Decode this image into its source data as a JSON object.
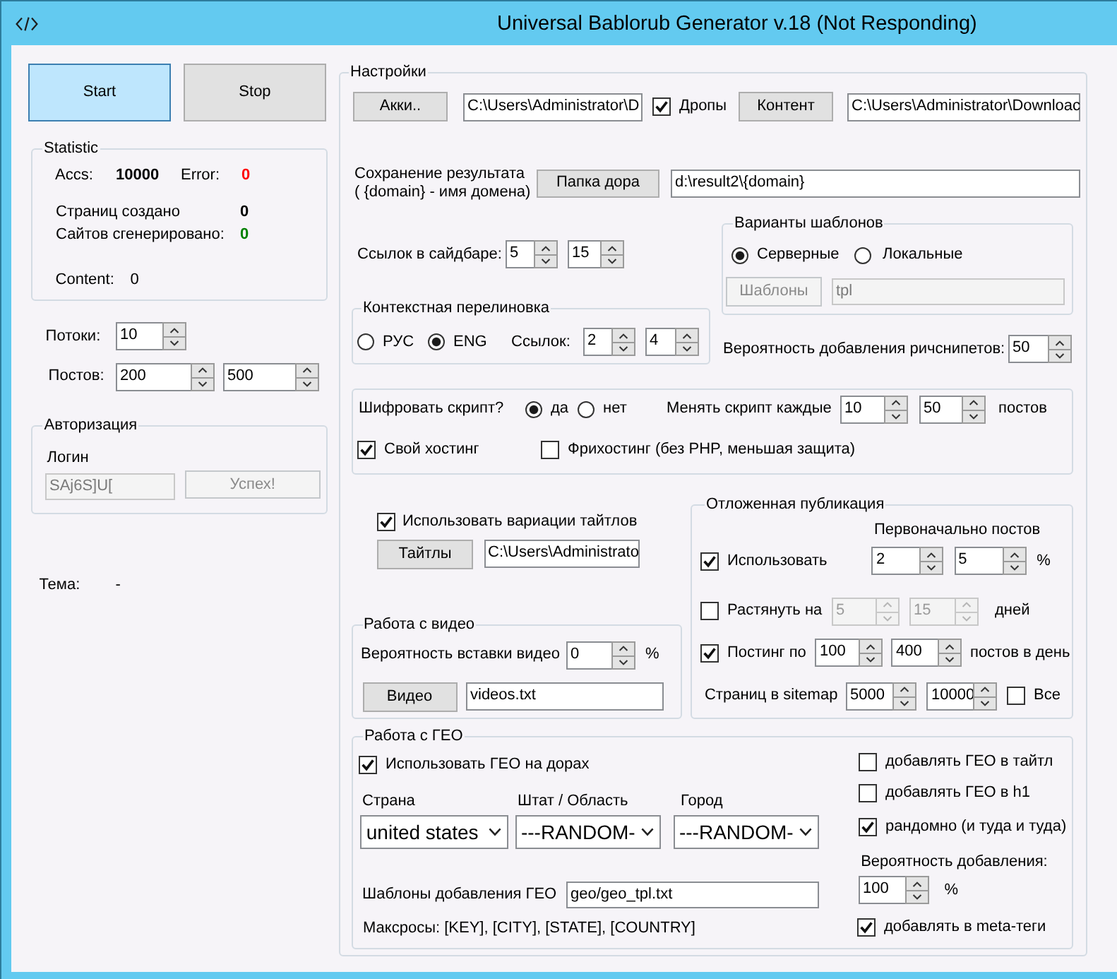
{
  "window": {
    "title": "Universal Bablorub Generator v.18 (Not Responding)"
  },
  "actions": [
    {
      "label": "Start",
      "highlighted": true
    },
    {
      "label": "Stop",
      "highlighted": false
    }
  ],
  "statistic": {
    "title": "Statistic",
    "top_row": [
      {
        "label": "Accs:",
        "value": "10000",
        "color": "#000000"
      },
      {
        "label": "Error:",
        "value": "0",
        "color": "#ff0000"
      }
    ],
    "counters": [
      {
        "label": "Страниц создано",
        "value": "0",
        "color": "#000000"
      },
      {
        "label": "Сайтов сгенерировано:",
        "value": "0",
        "color": "#008000"
      }
    ],
    "content": {
      "label": "Content:",
      "value": "0"
    }
  },
  "threads": {
    "label": "Потоки:",
    "values": [
      {
        "value": "10"
      }
    ]
  },
  "posts": {
    "label": "Постов:",
    "values": [
      {
        "value": "200"
      },
      {
        "value": "500"
      }
    ]
  },
  "authorization": {
    "title": "Авторизация",
    "login_label": "Логин",
    "login": {
      "value": "SAj6S]U[",
      "disabled": true
    },
    "button": {
      "label": "Успех!",
      "disabled": true
    }
  },
  "theme": {
    "label": "Тема:",
    "value": "-"
  },
  "settings": {
    "title": "Настройки",
    "accounts": {
      "button": {
        "label": "Акки.."
      },
      "path": {
        "value": "C:\\Users\\Administrator\\D"
      }
    },
    "drops": {
      "label": "Дропы",
      "checked": true
    },
    "content": {
      "button": {
        "label": "Контент"
      },
      "path": {
        "value": "C:\\Users\\Administrator\\Downloac"
      }
    },
    "output": {
      "label_lines": [
        "Сохранение результата",
        "( {domain} - имя домена)"
      ],
      "button": {
        "label": "Папка дора"
      },
      "path": {
        "value": "d:\\result2\\{domain}"
      }
    },
    "sidebar_links": {
      "label": "Ссылок в сайдбаре:",
      "values": [
        {
          "value": "5"
        },
        {
          "value": "15"
        }
      ]
    },
    "context_linking": {
      "title": "Контекстная перелиновка",
      "languages": [
        {
          "label": "РУС",
          "selected": false
        },
        {
          "label": "ENG",
          "selected": true
        }
      ],
      "links_label": "Ссылок:",
      "values": [
        {
          "value": "2"
        },
        {
          "value": "4"
        }
      ]
    },
    "template_variants": {
      "title": "Варианты шаблонов",
      "options": [
        {
          "label": "Серверные",
          "selected": true
        },
        {
          "label": "Локальные",
          "selected": false
        }
      ],
      "button": {
        "label": "Шаблоны",
        "disabled": true
      },
      "path": {
        "value": "tpl",
        "disabled": true
      }
    },
    "rich_snippets": {
      "label": "Вероятность добавления ричснипетов:",
      "values": [
        {
          "value": "50"
        }
      ]
    },
    "script": {
      "encrypt_label": "Шифровать скрипт?",
      "encrypt_options": [
        {
          "label": "да",
          "selected": true
        },
        {
          "label": "нет",
          "selected": false
        }
      ],
      "change_label": "Менять скрипт каждые",
      "values": [
        {
          "value": "10"
        },
        {
          "value": "50"
        }
      ],
      "unit": "постов",
      "hosting": [
        {
          "label": "Свой хостинг",
          "checked": true
        },
        {
          "label": "Фрихостинг (без PHP, меньшая защита)",
          "checked": false
        }
      ]
    },
    "titles": {
      "use": {
        "label": "Использовать вариации тайтлов",
        "checked": true
      },
      "button": {
        "label": "Тайтлы"
      },
      "path": {
        "value": "C:\\Users\\Administrato"
      }
    },
    "video": {
      "title": "Работа с видео",
      "probability_label": "Вероятность вставки видео",
      "values": [
        {
          "value": "0"
        }
      ],
      "unit": "%",
      "button": {
        "label": "Видео"
      },
      "path": {
        "value": "videos.txt"
      }
    },
    "delayed": {
      "title": "Отложенная публикация",
      "initial_label": "Первоначально постов",
      "use": {
        "label": "Использовать",
        "checked": true,
        "values": [
          {
            "value": "2"
          },
          {
            "value": "5"
          }
        ],
        "unit": "%"
      },
      "stretch": {
        "label": "Растянуть на",
        "checked": false,
        "values": [
          {
            "value": "5",
            "disabled": true
          },
          {
            "value": "15",
            "disabled": true
          }
        ],
        "unit": "дней"
      },
      "posting": {
        "label": "Постинг по",
        "checked": true,
        "values": [
          {
            "value": "100"
          },
          {
            "value": "400"
          }
        ],
        "unit": "постов в день"
      },
      "sitemap": {
        "label": "Страниц в sitemap",
        "values": [
          {
            "value": "5000"
          },
          {
            "value": "10000"
          }
        ],
        "all": {
          "label": "Все",
          "checked": false
        }
      }
    },
    "geo": {
      "title": "Работа с ГЕО",
      "use": {
        "label": "Использовать ГЕО на дорах",
        "checked": true
      },
      "selects": [
        {
          "label": "Страна",
          "value": "united states"
        },
        {
          "label": "Штат / Область",
          "value": "---RANDOM-"
        },
        {
          "label": "Город",
          "value": "---RANDOM-"
        }
      ],
      "templates_label": "Шаблоны добавления ГЕО",
      "templates_path": {
        "value": "geo/geo_tpl.txt"
      },
      "macros": "Максросы: [KEY], [CITY], [STATE], [COUNTRY]",
      "options": [
        {
          "label": "добавлять ГЕО в тайтл",
          "checked": false
        },
        {
          "label": "добавлять ГЕО в h1",
          "checked": false
        },
        {
          "label": "рандомно (и туда и туда)",
          "checked": true
        }
      ],
      "probability_label": "Вероятность добавления:",
      "probability": {
        "value": "100"
      },
      "unit": "%",
      "meta": {
        "label": "добавлять в meta-теги",
        "checked": true
      }
    }
  }
}
